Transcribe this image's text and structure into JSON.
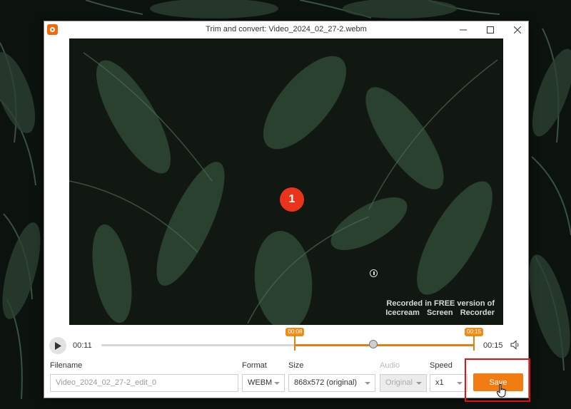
{
  "window": {
    "title": "Trim and convert: Video_2024_02_27-2.webm",
    "icons": {
      "app": "icecream-recorder-icon",
      "minimize": "minimize-icon",
      "maximize": "maximize-icon",
      "close": "close-icon"
    }
  },
  "video": {
    "step_marker": "1",
    "watermark_line1": "Recorded in FREE version of",
    "watermark_line2": "Icecream Screen Recorder"
  },
  "player": {
    "current_time": "00:11",
    "total_time": "00:15",
    "trim_start_label": "00:08",
    "trim_end_label": "00:15",
    "playhead_fraction": 0.73,
    "trim_start_fraction": 0.52,
    "trim_end_fraction": 1.0,
    "icons": {
      "play": "play-icon",
      "volume": "volume-icon"
    }
  },
  "form": {
    "filename_label": "Filename",
    "filename_placeholder": "Video_2024_02_27-2_edit_0",
    "format_label": "Format",
    "format_value": "WEBM",
    "size_label": "Size",
    "size_value": "868x572 (original)",
    "audio_label": "Audio",
    "audio_value": "Original",
    "speed_label": "Speed",
    "speed_value": "x1",
    "save_label": "Save"
  },
  "colors": {
    "accent": "#f07c12",
    "highlight": "#e8100c",
    "marker": "#e8341c"
  }
}
